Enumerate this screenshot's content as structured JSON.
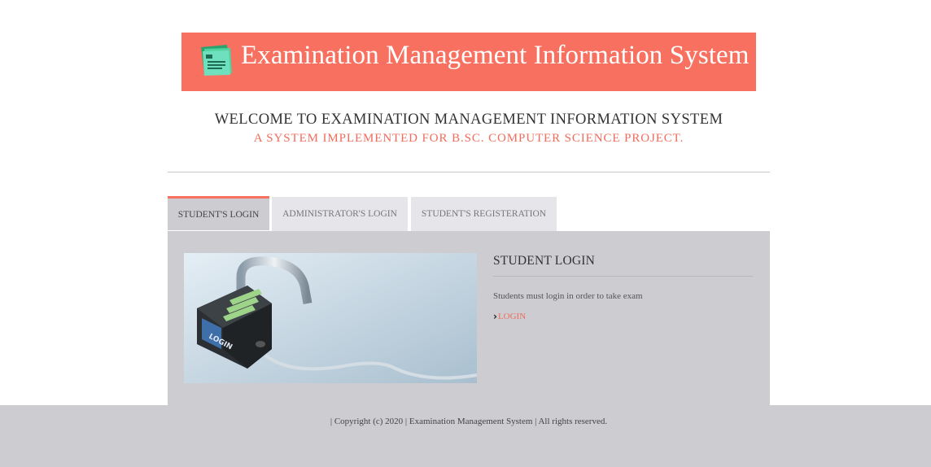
{
  "header": {
    "title": "Examination Management Information System",
    "logo_icon": "document-stack-icon",
    "background": "#f87060"
  },
  "welcome": {
    "heading": "WELCOME TO EXAMINATION MANAGEMENT INFORMATION SYSTEM",
    "subheading": "A SYSTEM IMPLEMENTED FOR B.SC. COMPUTER SCIENCE PROJECT."
  },
  "tabs": [
    {
      "label": "STUDENT'S LOGIN",
      "active": true
    },
    {
      "label": "ADMINISTRATOR'S LOGIN",
      "active": false
    },
    {
      "label": "STUDENT'S REGISTERATION",
      "active": false
    }
  ],
  "panel": {
    "heading": "STUDENT LOGIN",
    "description": "Students must login in order to take exam",
    "link_label": "LOGIN",
    "link_icon": "chevron-right-icon",
    "image_icon": "padlock-login-image",
    "image_text": "LOGIN"
  },
  "footer": {
    "copyright": "| Copyright (c) 2020 | Examination Management System | All rights reserved."
  },
  "colors": {
    "accent": "#f87060",
    "accent_text": "#f26b5b",
    "panel_bg": "#cdccd1",
    "tab_bg": "#e6e5ea"
  }
}
